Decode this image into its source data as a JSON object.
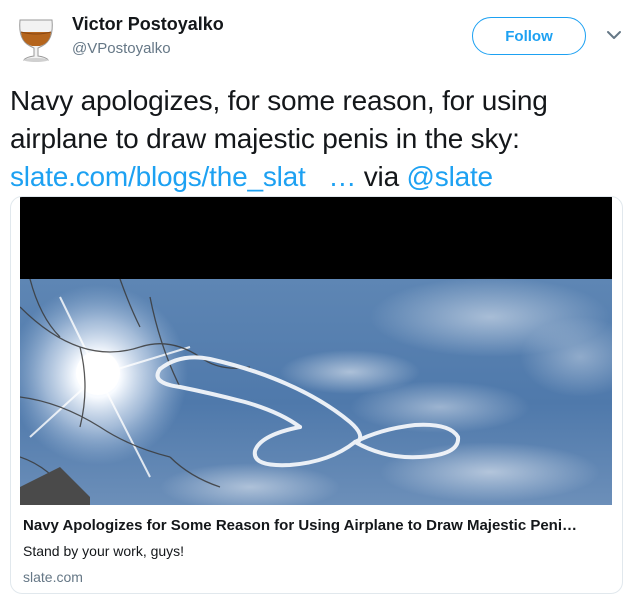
{
  "user": {
    "display_name": "Victor Postoyalko",
    "handle": "@VPostoyalko"
  },
  "actions": {
    "follow_label": "Follow"
  },
  "tweet": {
    "text_main": "Navy apologizes, for some reason, for using airplane to draw majestic penis in the sky:",
    "link_text": "slate.com/blogs/the_slat",
    "ellipsis": "…",
    "via": "via",
    "mention": "@slate"
  },
  "card": {
    "title": "Navy Apologizes for Some Reason for Using Airplane to Draw Majestic Peni…",
    "description": "Stand by your work, guys!",
    "domain": "slate.com"
  },
  "colors": {
    "accent": "#1da1f2",
    "secondary_text": "#657786",
    "primary_text": "#14171a",
    "card_border": "#e1e8ed"
  },
  "icons": {
    "avatar": "brandy-glass-icon",
    "menu": "chevron-down-icon"
  }
}
